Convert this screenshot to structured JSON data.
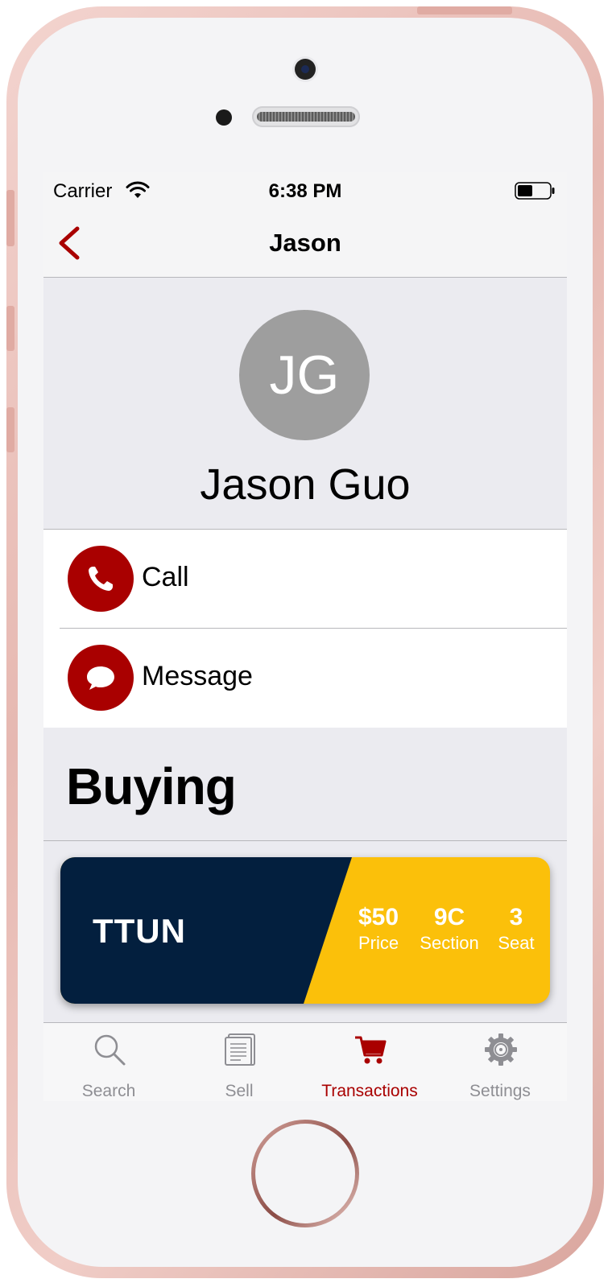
{
  "status_bar": {
    "carrier": "Carrier",
    "time": "6:38 PM"
  },
  "nav": {
    "title": "Jason",
    "back_icon": "chevron-left-icon"
  },
  "profile": {
    "initials": "JG",
    "name": "Jason Guo"
  },
  "actions": [
    {
      "label": "Call",
      "icon": "phone-icon"
    },
    {
      "label": "Message",
      "icon": "chat-bubble-icon"
    }
  ],
  "section": {
    "title": "Buying"
  },
  "ticket": {
    "team": "TTUN",
    "price": {
      "value": "$50",
      "label": "Price"
    },
    "section": {
      "value": "9C",
      "label": "Section"
    },
    "seat": {
      "value": "3",
      "label": "Seat"
    }
  },
  "tabbar": {
    "items": [
      {
        "label": "Search",
        "icon": "magnifier-icon"
      },
      {
        "label": "Sell",
        "icon": "document-icon"
      },
      {
        "label": "Transactions",
        "icon": "cart-icon",
        "active": true
      },
      {
        "label": "Settings",
        "icon": "gear-icon"
      }
    ]
  },
  "colors": {
    "accent": "#a90000",
    "ticket_navy": "#031f3e",
    "ticket_gold": "#fbc00a",
    "avatar_gray": "#9e9e9e"
  }
}
